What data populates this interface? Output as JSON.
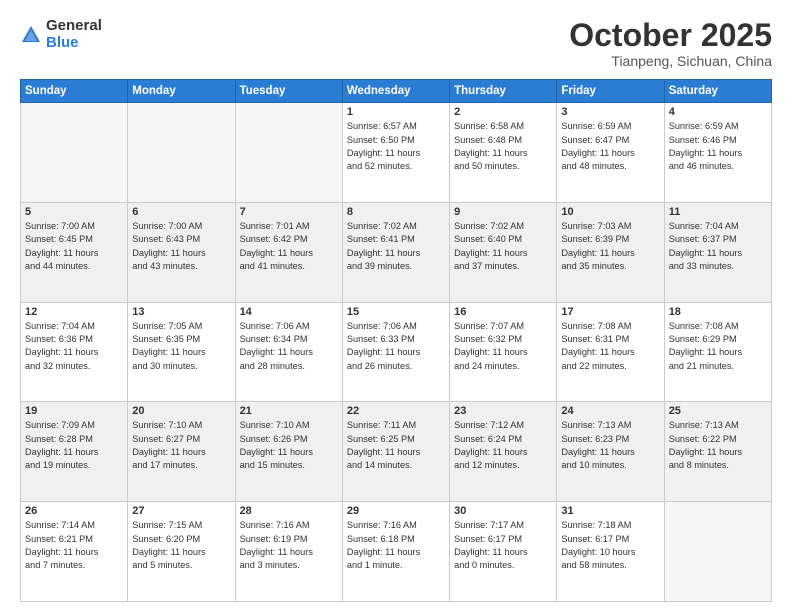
{
  "logo": {
    "general": "General",
    "blue": "Blue"
  },
  "header": {
    "month": "October 2025",
    "location": "Tianpeng, Sichuan, China"
  },
  "weekdays": [
    "Sunday",
    "Monday",
    "Tuesday",
    "Wednesday",
    "Thursday",
    "Friday",
    "Saturday"
  ],
  "weeks": [
    [
      {
        "day": "",
        "info": "",
        "empty": true
      },
      {
        "day": "",
        "info": "",
        "empty": true
      },
      {
        "day": "",
        "info": "",
        "empty": true
      },
      {
        "day": "1",
        "info": "Sunrise: 6:57 AM\nSunset: 6:50 PM\nDaylight: 11 hours\nand 52 minutes."
      },
      {
        "day": "2",
        "info": "Sunrise: 6:58 AM\nSunset: 6:48 PM\nDaylight: 11 hours\nand 50 minutes."
      },
      {
        "day": "3",
        "info": "Sunrise: 6:59 AM\nSunset: 6:47 PM\nDaylight: 11 hours\nand 48 minutes."
      },
      {
        "day": "4",
        "info": "Sunrise: 6:59 AM\nSunset: 6:46 PM\nDaylight: 11 hours\nand 46 minutes."
      }
    ],
    [
      {
        "day": "5",
        "info": "Sunrise: 7:00 AM\nSunset: 6:45 PM\nDaylight: 11 hours\nand 44 minutes."
      },
      {
        "day": "6",
        "info": "Sunrise: 7:00 AM\nSunset: 6:43 PM\nDaylight: 11 hours\nand 43 minutes."
      },
      {
        "day": "7",
        "info": "Sunrise: 7:01 AM\nSunset: 6:42 PM\nDaylight: 11 hours\nand 41 minutes."
      },
      {
        "day": "8",
        "info": "Sunrise: 7:02 AM\nSunset: 6:41 PM\nDaylight: 11 hours\nand 39 minutes."
      },
      {
        "day": "9",
        "info": "Sunrise: 7:02 AM\nSunset: 6:40 PM\nDaylight: 11 hours\nand 37 minutes."
      },
      {
        "day": "10",
        "info": "Sunrise: 7:03 AM\nSunset: 6:39 PM\nDaylight: 11 hours\nand 35 minutes."
      },
      {
        "day": "11",
        "info": "Sunrise: 7:04 AM\nSunset: 6:37 PM\nDaylight: 11 hours\nand 33 minutes."
      }
    ],
    [
      {
        "day": "12",
        "info": "Sunrise: 7:04 AM\nSunset: 6:36 PM\nDaylight: 11 hours\nand 32 minutes."
      },
      {
        "day": "13",
        "info": "Sunrise: 7:05 AM\nSunset: 6:35 PM\nDaylight: 11 hours\nand 30 minutes."
      },
      {
        "day": "14",
        "info": "Sunrise: 7:06 AM\nSunset: 6:34 PM\nDaylight: 11 hours\nand 28 minutes."
      },
      {
        "day": "15",
        "info": "Sunrise: 7:06 AM\nSunset: 6:33 PM\nDaylight: 11 hours\nand 26 minutes."
      },
      {
        "day": "16",
        "info": "Sunrise: 7:07 AM\nSunset: 6:32 PM\nDaylight: 11 hours\nand 24 minutes."
      },
      {
        "day": "17",
        "info": "Sunrise: 7:08 AM\nSunset: 6:31 PM\nDaylight: 11 hours\nand 22 minutes."
      },
      {
        "day": "18",
        "info": "Sunrise: 7:08 AM\nSunset: 6:29 PM\nDaylight: 11 hours\nand 21 minutes."
      }
    ],
    [
      {
        "day": "19",
        "info": "Sunrise: 7:09 AM\nSunset: 6:28 PM\nDaylight: 11 hours\nand 19 minutes."
      },
      {
        "day": "20",
        "info": "Sunrise: 7:10 AM\nSunset: 6:27 PM\nDaylight: 11 hours\nand 17 minutes."
      },
      {
        "day": "21",
        "info": "Sunrise: 7:10 AM\nSunset: 6:26 PM\nDaylight: 11 hours\nand 15 minutes."
      },
      {
        "day": "22",
        "info": "Sunrise: 7:11 AM\nSunset: 6:25 PM\nDaylight: 11 hours\nand 14 minutes."
      },
      {
        "day": "23",
        "info": "Sunrise: 7:12 AM\nSunset: 6:24 PM\nDaylight: 11 hours\nand 12 minutes."
      },
      {
        "day": "24",
        "info": "Sunrise: 7:13 AM\nSunset: 6:23 PM\nDaylight: 11 hours\nand 10 minutes."
      },
      {
        "day": "25",
        "info": "Sunrise: 7:13 AM\nSunset: 6:22 PM\nDaylight: 11 hours\nand 8 minutes."
      }
    ],
    [
      {
        "day": "26",
        "info": "Sunrise: 7:14 AM\nSunset: 6:21 PM\nDaylight: 11 hours\nand 7 minutes."
      },
      {
        "day": "27",
        "info": "Sunrise: 7:15 AM\nSunset: 6:20 PM\nDaylight: 11 hours\nand 5 minutes."
      },
      {
        "day": "28",
        "info": "Sunrise: 7:16 AM\nSunset: 6:19 PM\nDaylight: 11 hours\nand 3 minutes."
      },
      {
        "day": "29",
        "info": "Sunrise: 7:16 AM\nSunset: 6:18 PM\nDaylight: 11 hours\nand 1 minute."
      },
      {
        "day": "30",
        "info": "Sunrise: 7:17 AM\nSunset: 6:17 PM\nDaylight: 11 hours\nand 0 minutes."
      },
      {
        "day": "31",
        "info": "Sunrise: 7:18 AM\nSunset: 6:17 PM\nDaylight: 10 hours\nand 58 minutes."
      },
      {
        "day": "",
        "info": "",
        "empty": true
      }
    ]
  ]
}
